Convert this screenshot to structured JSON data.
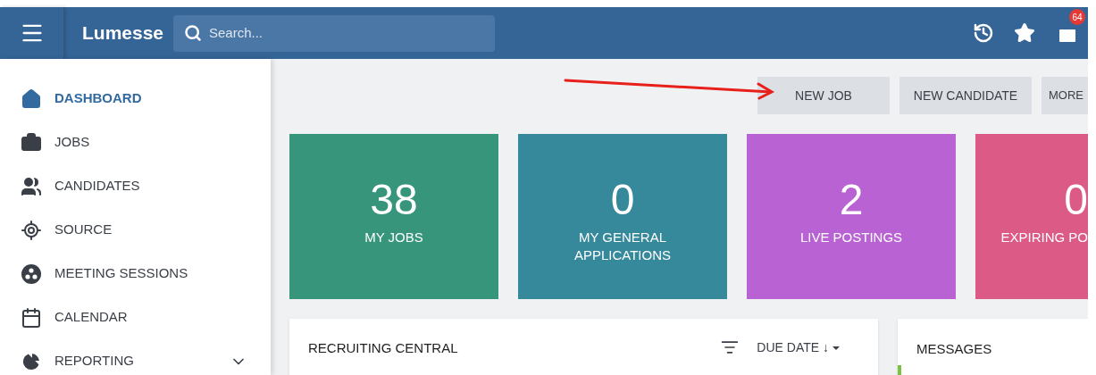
{
  "header": {
    "logo": "Lumesse",
    "search": {
      "placeholder": "Search..."
    },
    "mail_badge": "64"
  },
  "sidebar": {
    "items": [
      {
        "label": "DASHBOARD",
        "selected": true
      },
      {
        "label": "JOBS",
        "selected": false
      },
      {
        "label": "CANDIDATES",
        "selected": false
      },
      {
        "label": "SOURCE",
        "selected": false
      },
      {
        "label": "MEETING SESSIONS",
        "selected": false
      },
      {
        "label": "CALENDAR",
        "selected": false
      },
      {
        "label": "REPORTING",
        "selected": false,
        "expanded": false
      }
    ]
  },
  "actions": [
    "NEW JOB",
    "NEW CANDIDATE",
    "MORE"
  ],
  "tiles": [
    {
      "value": "38",
      "label": "MY JOBS",
      "color": "#36957a"
    },
    {
      "value": "0",
      "label": "MY GENERAL APPLICATIONS",
      "color": "#36899a"
    },
    {
      "value": "2",
      "label": "LIVE POSTINGS",
      "color": "#b862d3"
    },
    {
      "value": "0",
      "label": "EXPIRING PO",
      "color": "#db5a86"
    }
  ],
  "recruiting_central": {
    "title": "RECRUITING CENTRAL",
    "sort": "DUE DATE ↓"
  },
  "messages": {
    "title": "MESSAGES"
  }
}
